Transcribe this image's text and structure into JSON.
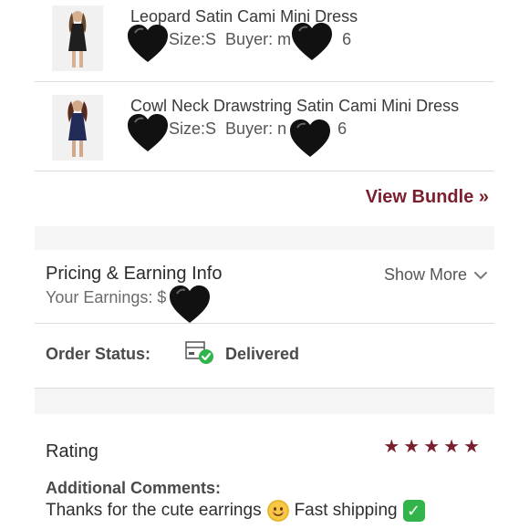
{
  "items": [
    {
      "title": "Leopard Satin Cami Mini Dress",
      "size_label": "Size:S",
      "buyer_label": "Buyer: m",
      "buyer_tail": "6"
    },
    {
      "title": "Cowl Neck Drawstring Satin Cami Mini Dress",
      "size_label": "Size:S",
      "buyer_label": "Buyer: n",
      "buyer_tail": "6"
    }
  ],
  "bundle": {
    "view_label": "View Bundle »"
  },
  "pricing": {
    "title": "Pricing & Earning Info",
    "earnings_label": "Your Earnings: $",
    "show_more_label": "Show More"
  },
  "order": {
    "status_label": "Order Status:",
    "status_value": "Delivered"
  },
  "rating": {
    "title": "Rating",
    "stars": 5,
    "comments_label": "Additional Comments:",
    "comment_text_1": "Thanks for the cute earrings",
    "comment_text_2": "Fast shipping"
  },
  "colors": {
    "accent": "#7a1f2e",
    "divider": "#dddddd",
    "section_gap": "#f5f5f5",
    "success": "#31b54b"
  }
}
